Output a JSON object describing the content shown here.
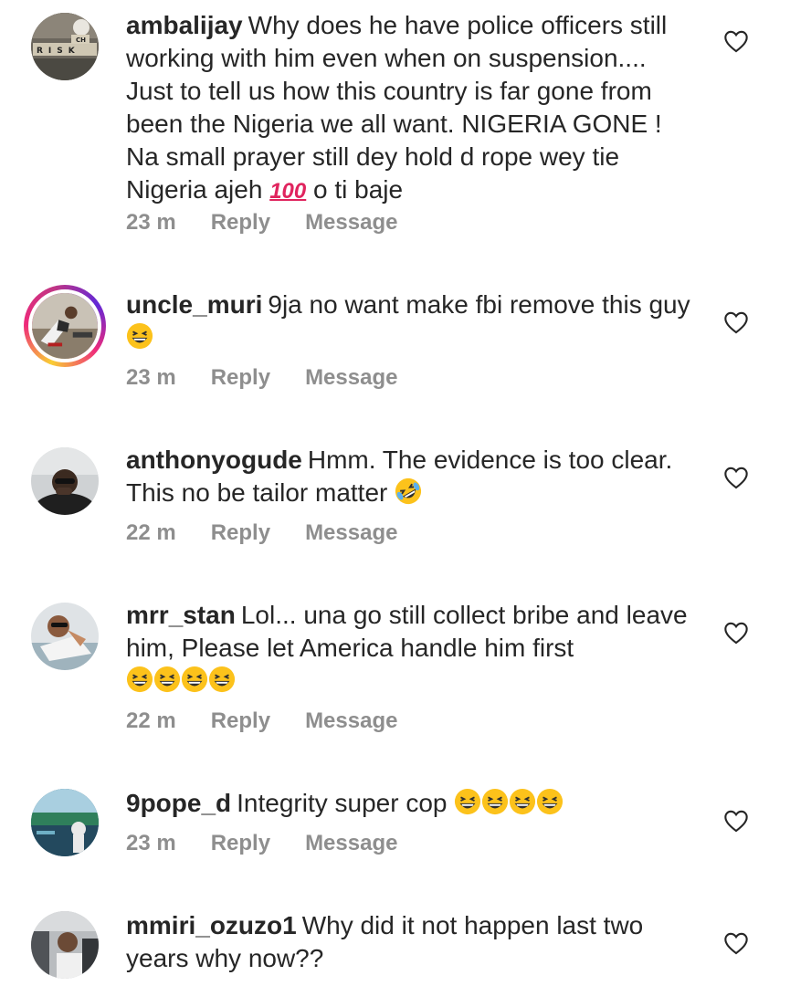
{
  "comments": [
    {
      "username": "ambalijay",
      "text_lines": [
        "Why does he have police officers still",
        "working with him even when on suspension....",
        "Just to tell us how this country is far gone from",
        "been the Nigeria we all want. NIGERIA GONE !",
        "Na small prayer still dey hold d rope wey tie"
      ],
      "last_line_before": "Nigeria ajeh",
      "emoji_100": "100",
      "last_line_after": "o ti baje",
      "time": "23 m",
      "reply_label": "Reply",
      "message_label": "Message",
      "avatar_text": "RISK",
      "avatar_text_small": "CH"
    },
    {
      "username": "uncle_muri",
      "text": "9ja no want make fbi remove this guy",
      "time": "23 m",
      "reply_label": "Reply",
      "message_label": "Message"
    },
    {
      "username": "anthonyogude",
      "text": "Hmm. The evidence is too clear. This no be tailor matter",
      "time": "22 m",
      "reply_label": "Reply",
      "message_label": "Message"
    },
    {
      "username": "mrr_stan",
      "text": "Lol... una go still collect bribe and leave him, Please let America handle him first",
      "time": "22 m",
      "reply_label": "Reply",
      "message_label": "Message"
    },
    {
      "username": "9pope_d",
      "text": "Integrity super cop",
      "time": "23 m",
      "reply_label": "Reply",
      "message_label": "Message"
    },
    {
      "username": "mmiri_ozuzo1",
      "text": "Why did it not happen last two years why now??"
    }
  ],
  "icons": {
    "like": "heart-outline-icon",
    "laugh_emoji": "grinning-squinting-face",
    "tears_emoji": "rolling-on-floor-laughing",
    "hundred_emoji": "hundred-points"
  },
  "colors": {
    "text": "#262626",
    "meta": "#8e8e8e",
    "emoji_face": "#fcc21b",
    "story_ring": "#ee2a7b"
  }
}
